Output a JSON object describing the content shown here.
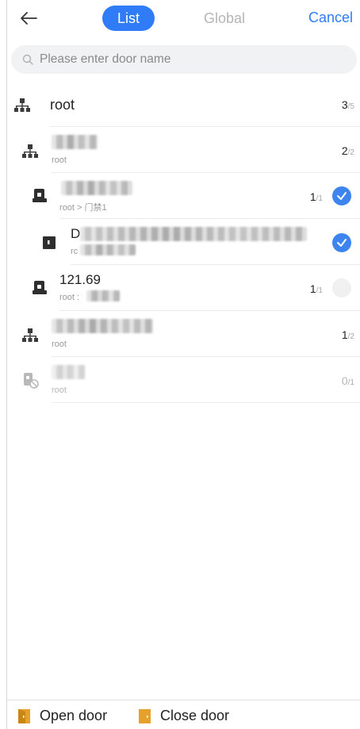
{
  "header": {
    "tabs": [
      {
        "label": "List",
        "active": true
      },
      {
        "label": "Global",
        "active": false
      }
    ],
    "cancel_label": "Cancel"
  },
  "search": {
    "placeholder": "Please enter door name"
  },
  "rows": [
    {
      "type": "org",
      "title": "root",
      "subtitle": "",
      "count": "3",
      "total": "/5"
    },
    {
      "type": "org",
      "title": "",
      "subtitle": "root",
      "count": "2",
      "total": "/2"
    },
    {
      "type": "door",
      "title": "",
      "subtitle": "root > 门禁1",
      "count": "1",
      "total": "/1",
      "checked": true
    },
    {
      "type": "door",
      "title": "D",
      "subtitle": "rc",
      "count": "",
      "total": "",
      "checked": true
    },
    {
      "type": "door",
      "title": "121.69",
      "subtitle": "root :",
      "count": "1",
      "total": "/1",
      "checked": false
    },
    {
      "type": "org",
      "title": "",
      "subtitle": "root",
      "count": "1",
      "total": "/2"
    },
    {
      "type": "door-offline",
      "title": "",
      "subtitle": "root",
      "count": "0",
      "total": "/1"
    }
  ],
  "footer": {
    "open_label": "Open door",
    "close_label": "Close door"
  },
  "colors": {
    "accent": "#2f7cf6",
    "check": "#3d84ee",
    "door_action": "#e6a12a"
  }
}
